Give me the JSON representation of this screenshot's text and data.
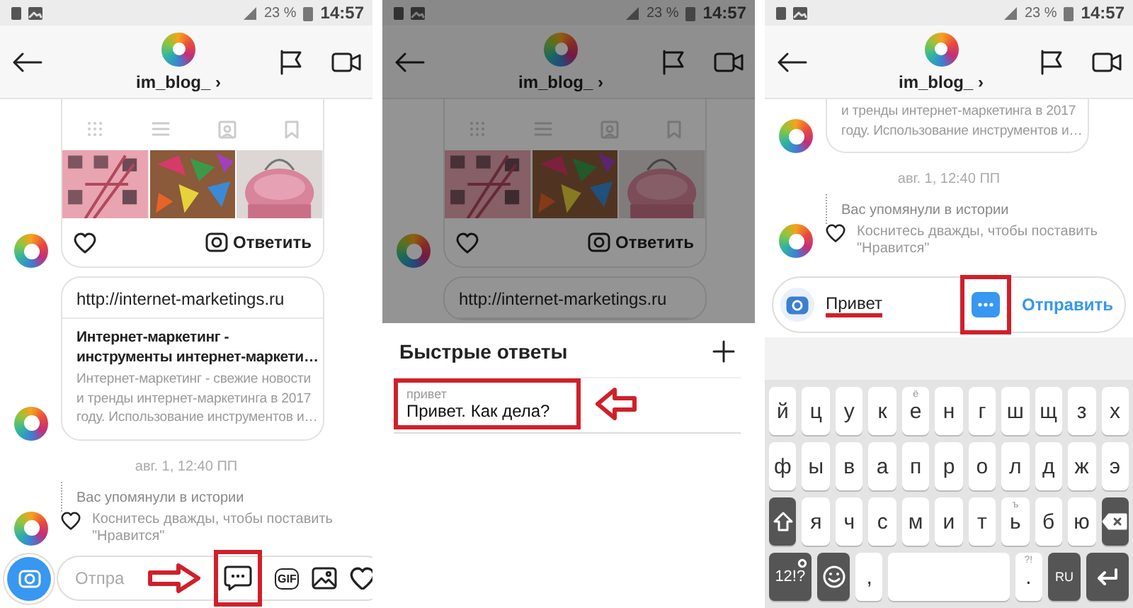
{
  "screens": [
    {
      "status_bar": {
        "battery_percent": "23 %",
        "time": "14:57"
      },
      "header": {
        "username": "im_blog_",
        "chevron": "›"
      },
      "dimmed": false,
      "messages": [
        {
          "kind": "post_card",
          "avatar": true,
          "reply_label": "Ответить"
        },
        {
          "kind": "link_card",
          "avatar": true,
          "url": "http://internet-marketings.ru",
          "title_lines": [
            "Интернет-маркетинг -",
            "инструменты интернет-маркети…"
          ],
          "description_lines": [
            "Интернет-маркетинг - свежие новости",
            "и тренды интернет-маркетинга в 2017",
            "году. Использование инструментов и…"
          ]
        },
        {
          "kind": "timestamp",
          "text": "авг. 1, 12:40 ПП"
        },
        {
          "kind": "story_mention",
          "avatar": true,
          "label": "Вас упомянули в истории",
          "hint_lines": [
            "Коснитесь дважды, чтобы поставить",
            "\"Нравится\""
          ]
        }
      ],
      "composer": {
        "kind": "empty",
        "placeholder": "Отпра",
        "pointer_arrow": true,
        "highlight_quick_reply": true,
        "gif_label": "GIF"
      }
    },
    {
      "status_bar": {
        "battery_percent": "23 %",
        "time": "14:57"
      },
      "header": {
        "username": "im_blog_",
        "chevron": "›"
      },
      "dimmed": true,
      "messages": [
        {
          "kind": "post_card",
          "avatar": true,
          "reply_label": "Ответить"
        },
        {
          "kind": "link_card",
          "avatar": false,
          "url": "http://internet-marketings.ru"
        }
      ],
      "quick_replies": {
        "title": "Быстрые ответы",
        "items": [
          {
            "shortcut": "привет",
            "text": "Привет. Как дела?",
            "highlighted": true,
            "pointer_arrow": true
          }
        ]
      }
    },
    {
      "status_bar": {
        "battery_percent": "23 %",
        "time": "14:57"
      },
      "header": {
        "username": "im_blog_",
        "chevron": "›"
      },
      "dimmed": false,
      "messages": [
        {
          "kind": "link_card",
          "avatar": true,
          "description_lines": [
            "и тренды интернет-маркетинга в 2017",
            "году. Использование инструментов и…"
          ]
        },
        {
          "kind": "timestamp",
          "text": "авг. 1, 12:40 ПП"
        },
        {
          "kind": "story_mention",
          "avatar": true,
          "label": "Вас упомянули в истории",
          "hint_lines": [
            "Коснитесь дважды, чтобы поставить",
            "\"Нравится\""
          ]
        }
      ],
      "composer": {
        "kind": "typed",
        "value": "Привет",
        "underline_value": true,
        "highlight_quick_reply": true,
        "send_label": "Отправить"
      },
      "keyboard": {
        "rows": [
          [
            {
              "kind": "letter",
              "label": "й"
            },
            {
              "kind": "letter",
              "label": "ц"
            },
            {
              "kind": "letter",
              "label": "у"
            },
            {
              "kind": "letter",
              "label": "к"
            },
            {
              "kind": "letter",
              "label": "е",
              "hint": "ё"
            },
            {
              "kind": "letter",
              "label": "н"
            },
            {
              "kind": "letter",
              "label": "г"
            },
            {
              "kind": "letter",
              "label": "ш"
            },
            {
              "kind": "letter",
              "label": "щ"
            },
            {
              "kind": "letter",
              "label": "з"
            },
            {
              "kind": "letter",
              "label": "х"
            }
          ],
          [
            {
              "kind": "letter",
              "label": "ф"
            },
            {
              "kind": "letter",
              "label": "ы"
            },
            {
              "kind": "letter",
              "label": "в"
            },
            {
              "kind": "letter",
              "label": "а"
            },
            {
              "kind": "letter",
              "label": "п"
            },
            {
              "kind": "letter",
              "label": "р"
            },
            {
              "kind": "letter",
              "label": "о"
            },
            {
              "kind": "letter",
              "label": "л"
            },
            {
              "kind": "letter",
              "label": "д"
            },
            {
              "kind": "letter",
              "label": "ж"
            },
            {
              "kind": "letter",
              "label": "э"
            }
          ],
          [
            {
              "kind": "shift"
            },
            {
              "kind": "letter",
              "label": "я"
            },
            {
              "kind": "letter",
              "label": "ч"
            },
            {
              "kind": "letter",
              "label": "с"
            },
            {
              "kind": "letter",
              "label": "м"
            },
            {
              "kind": "letter",
              "label": "и"
            },
            {
              "kind": "letter",
              "label": "т"
            },
            {
              "kind": "letter",
              "label": "ь",
              "hint": "ъ"
            },
            {
              "kind": "letter",
              "label": "б"
            },
            {
              "kind": "letter",
              "label": "ю"
            },
            {
              "kind": "backspace"
            }
          ],
          [
            {
              "kind": "symbols",
              "label": "12!?"
            },
            {
              "kind": "emoji"
            },
            {
              "kind": "punct",
              "label": ","
            },
            {
              "kind": "space"
            },
            {
              "kind": "punct",
              "label": ".",
              "hint": "?!"
            },
            {
              "kind": "lang",
              "label": "RU"
            },
            {
              "kind": "enter"
            }
          ]
        ]
      }
    }
  ]
}
